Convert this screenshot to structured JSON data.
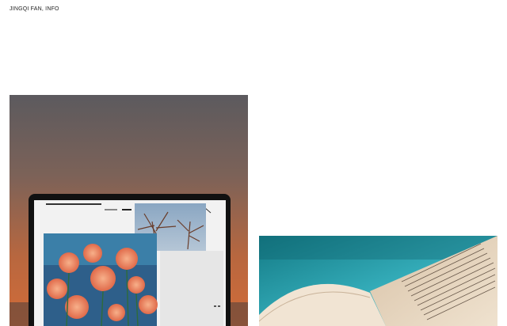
{
  "site": {
    "title": "JINGQI FAN, INFO"
  },
  "gallery": {
    "items": [
      {
        "icon": "laptop-photo"
      },
      {
        "icon": "open-book-photo"
      }
    ]
  },
  "colors": {
    "background": "#ffffff",
    "text": "#222222",
    "sunset_top": "#5e5b5e",
    "sunset_bottom": "#cf6a3a",
    "water": "#2aa0b0",
    "paper": "#e4d0b8"
  }
}
